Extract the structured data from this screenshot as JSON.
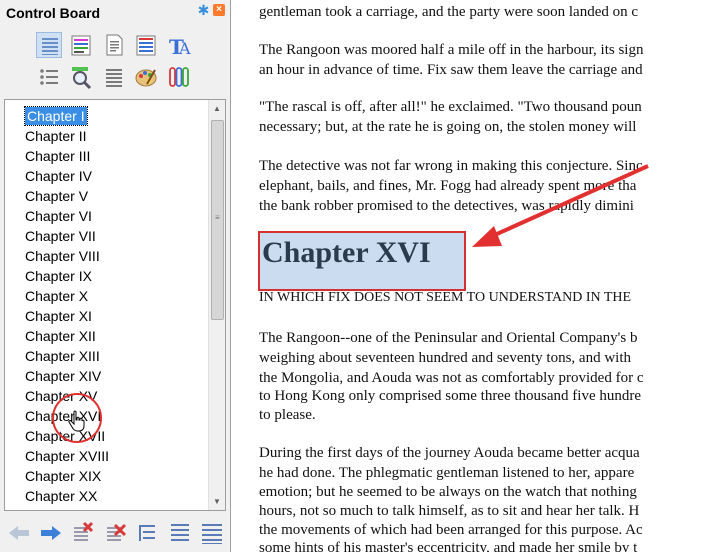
{
  "sidebar": {
    "title": "Control Board",
    "chapters": [
      "Chapter I",
      "Chapter II",
      "Chapter III",
      "Chapter IV",
      "Chapter V",
      "Chapter VI",
      "Chapter VII",
      "Chapter VIII",
      "Chapter IX",
      "Chapter X",
      "Chapter XI",
      "Chapter XII",
      "Chapter XIII",
      "Chapter XIV",
      "Chapter XV",
      "Chapter XVI",
      "Chapter XVII",
      "Chapter XVIII",
      "Chapter XIX",
      "Chapter XX"
    ],
    "selected_index": 0,
    "toolbar_icons": [
      "show-headings-icon",
      "text-view-icon",
      "document-icon",
      "list-view-icon",
      "font-style-icon",
      "bullet-list-icon",
      "find-icon",
      "align-icon",
      "palette-icon",
      "attachment-icon"
    ],
    "bottom_icons": [
      "back-arrow-icon",
      "forward-arrow-icon",
      "delete-icon",
      "delete-all-icon",
      "outline-icon",
      "collapse-icon",
      "expand-icon"
    ],
    "accent_color": "#3a8ee6"
  },
  "document": {
    "lines_top": [
      "gentleman took a carriage, and the party were soon landed on c",
      "The Rangoon was moored half a mile off in the harbour, its sign",
      "an hour in advance of time. Fix saw them leave the carriage and",
      "\"The rascal is off, after all!\" he exclaimed. \"Two thousand poun",
      "necessary; but, at the rate he is going on, the stolen money will",
      "The detective was not far wrong in making this conjecture. Sinc",
      "elephant, bails, and fines, Mr. Fogg had already spent more tha",
      "the bank robber promised to the detectives, was rapidly dimini"
    ],
    "chapter_heading": "Chapter XVI",
    "chapter_subtitle": "IN WHICH FIX DOES NOT SEEM TO UNDERSTAND IN THE",
    "lines_bottom": [
      "The Rangoon--one of the Peninsular and Oriental Company's b",
      "weighing about seventeen hundred and seventy tons, and with",
      "the Mongolia, and Aouda was not as comfortably provided for c",
      "to Hong Kong only comprised some three thousand five hundre",
      "to please.",
      "During the first days of the journey Aouda became better acqua",
      "he had done. The phlegmatic gentleman listened to her, appare",
      "emotion; but he seemed to be always on the watch that nothing",
      "hours, not so much to talk himself, as to sit and hear her talk. H",
      "the movements of which had been arranged for this purpose. Ac",
      "some hints of his master's eccentricity, and made her smile by t"
    ],
    "highlight_color": "#cbdcf0",
    "annotation_color": "#e23030"
  }
}
